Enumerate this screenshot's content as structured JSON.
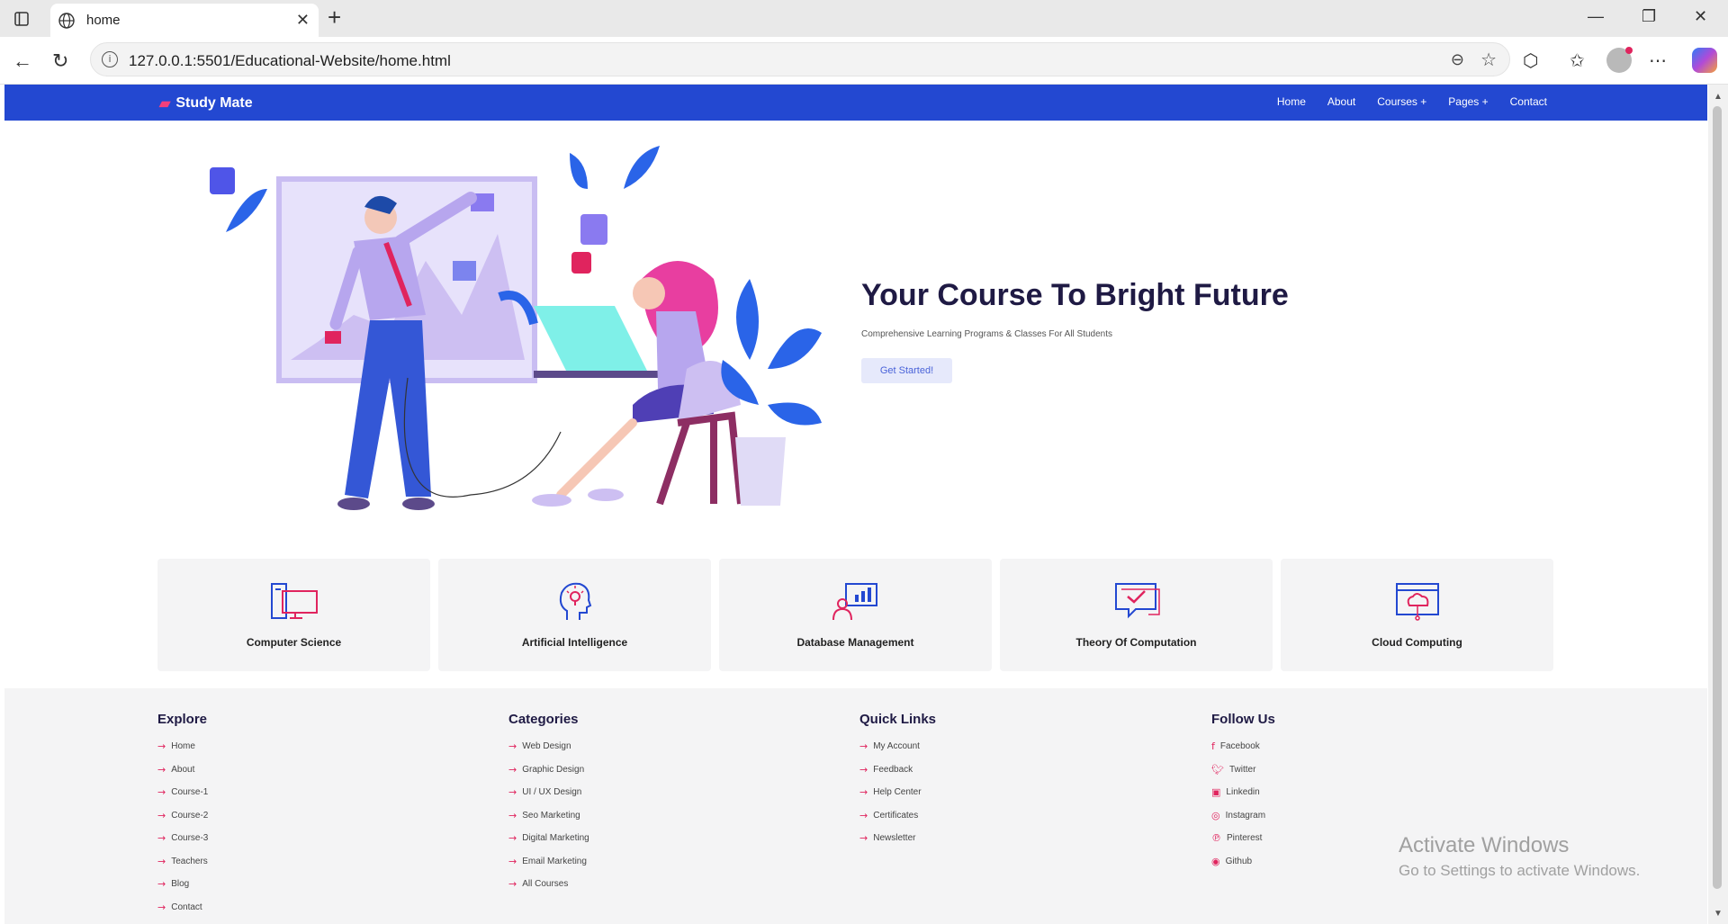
{
  "browser": {
    "tab_title": "home",
    "url": "127.0.0.1:5501/Educational-Website/home.html"
  },
  "site": {
    "brand": "Study Mate",
    "nav": [
      "Home",
      "About",
      "Courses +",
      "Pages +",
      "Contact"
    ]
  },
  "hero": {
    "title": "Your Course To Bright Future",
    "subtitle": "Comprehensive Learning Programs & Classes For All Students",
    "button": "Get Started!"
  },
  "courses": [
    {
      "label": "Computer Science",
      "icon": "computer-icon"
    },
    {
      "label": "Artificial Intelligence",
      "icon": "brain-bulb-icon"
    },
    {
      "label": "Database Management",
      "icon": "presentation-icon"
    },
    {
      "label": "Theory Of Computation",
      "icon": "chat-check-icon"
    },
    {
      "label": "Cloud Computing",
      "icon": "cloud-browser-icon"
    }
  ],
  "footer": {
    "explore": {
      "title": "Explore",
      "items": [
        "Home",
        "About",
        "Course-1",
        "Course-2",
        "Course-3",
        "Teachers",
        "Blog",
        "Contact"
      ]
    },
    "categories": {
      "title": "Categories",
      "items": [
        "Web Design",
        "Graphic Design",
        "UI / UX Design",
        "Seo Marketing",
        "Digital Marketing",
        "Email Marketing",
        "All Courses"
      ]
    },
    "quick_links": {
      "title": "Quick Links",
      "items": [
        "My Account",
        "Feedback",
        "Help Center",
        "Certificates",
        "Newsletter"
      ]
    },
    "follow_us": {
      "title": "Follow Us",
      "items": [
        "Facebook",
        "Twitter",
        "Linkedin",
        "Instagram",
        "Pinterest",
        "Github"
      ]
    }
  },
  "watermark": {
    "line1": "Activate Windows",
    "line2": "Go to Settings to activate Windows."
  },
  "colors": {
    "header": "#2348d1",
    "accent": "#e0245e",
    "title": "#1f1a44"
  }
}
